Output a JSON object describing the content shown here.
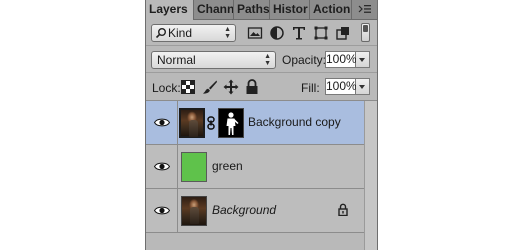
{
  "tabs": [
    {
      "label": "Layers",
      "active": true
    },
    {
      "label": "Chann",
      "active": false
    },
    {
      "label": "Paths",
      "active": false
    },
    {
      "label": "Histor",
      "active": false
    },
    {
      "label": "Action",
      "active": false
    }
  ],
  "filter": {
    "kind_label": "Kind",
    "icons": [
      "pixel-layer-filter-icon",
      "adjustment-layer-filter-icon",
      "type-layer-filter-icon",
      "shape-layer-filter-icon",
      "smart-object-filter-icon"
    ]
  },
  "blend": {
    "mode": "Normal",
    "opacity_label": "Opacity:",
    "opacity_value": "100%"
  },
  "lock": {
    "label": "Lock:",
    "fill_label": "Fill:",
    "fill_value": "100%"
  },
  "layers": [
    {
      "name": "Background copy",
      "selected": true,
      "has_mask": true,
      "italic": false,
      "locked": false
    },
    {
      "name": "green",
      "selected": false,
      "has_mask": false,
      "italic": false,
      "locked": false,
      "swatch_color": "#5fc24b"
    },
    {
      "name": "Background",
      "selected": false,
      "has_mask": false,
      "italic": true,
      "locked": true
    }
  ],
  "colors": {
    "panel_bg": "#b9b9b9",
    "selected_row": "#a9bddf",
    "green_swatch": "#5fc24b"
  }
}
